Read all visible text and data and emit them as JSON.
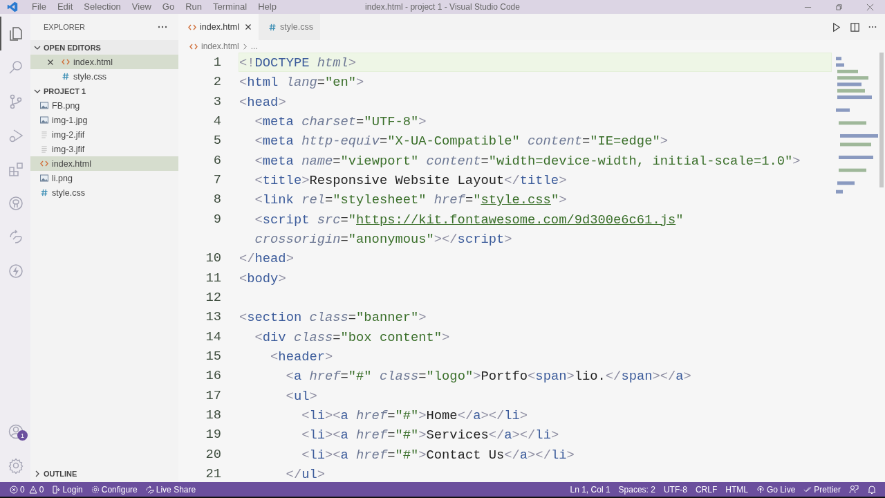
{
  "window": {
    "title": "index.html - project 1 - Visual Studio Code"
  },
  "menu": [
    "File",
    "Edit",
    "Selection",
    "View",
    "Go",
    "Run",
    "Terminal",
    "Help"
  ],
  "activity_bar": {
    "top": [
      {
        "kind": "explorer",
        "selected": true
      },
      {
        "kind": "search",
        "selected": false
      },
      {
        "kind": "source-control",
        "selected": false
      },
      {
        "kind": "run",
        "selected": false
      },
      {
        "kind": "extensions",
        "selected": false
      },
      {
        "kind": "github",
        "selected": false
      },
      {
        "kind": "live-share",
        "selected": false
      },
      {
        "kind": "lightning",
        "selected": false
      }
    ],
    "accounts_badge": "1"
  },
  "sidebar": {
    "title": "EXPLORER",
    "open_editors": {
      "label": "OPEN EDITORS",
      "expanded": true,
      "items": [
        {
          "name": "index.html",
          "kind": "html",
          "selected": true
        },
        {
          "name": "style.css",
          "kind": "css",
          "selected": false
        }
      ]
    },
    "project": {
      "label": "PROJECT 1",
      "expanded": true,
      "items": [
        {
          "name": "FB.png",
          "kind": "image",
          "selected": false
        },
        {
          "name": "img-1.jpg",
          "kind": "image",
          "selected": false
        },
        {
          "name": "img-2.jfif",
          "kind": "file",
          "selected": false
        },
        {
          "name": "img-3.jfif",
          "kind": "file",
          "selected": false
        },
        {
          "name": "index.html",
          "kind": "html",
          "selected": true
        },
        {
          "name": "li.png",
          "kind": "image",
          "selected": false
        },
        {
          "name": "style.css",
          "kind": "css",
          "selected": false
        }
      ]
    },
    "outline": {
      "label": "OUTLINE",
      "expanded": false
    }
  },
  "tabs": [
    {
      "label": "index.html",
      "kind": "html",
      "selected": true
    },
    {
      "label": "style.css",
      "kind": "css",
      "selected": false
    }
  ],
  "breadcrumb": {
    "file": "index.html",
    "kind": "html",
    "rest": "..."
  },
  "code": [
    {
      "number": "1",
      "current": true,
      "tokens": [
        {
          "kind": "p",
          "text": "<!"
        },
        {
          "kind": "t",
          "text": "DOCTYPE"
        },
        {
          "kind": "a",
          "text": " html"
        },
        {
          "kind": "p",
          "text": ">"
        }
      ]
    },
    {
      "number": "2",
      "current": false,
      "tokens": [
        {
          "kind": "p",
          "text": "<"
        },
        {
          "kind": "t",
          "text": "html"
        },
        {
          "kind": "a",
          "text": " lang"
        },
        {
          "kind": "o",
          "text": "="
        },
        {
          "kind": "s",
          "text": "\"en\""
        },
        {
          "kind": "p",
          "text": ">"
        }
      ]
    },
    {
      "number": "3",
      "current": false,
      "tokens": [
        {
          "kind": "p",
          "text": "<"
        },
        {
          "kind": "t",
          "text": "head"
        },
        {
          "kind": "p",
          "text": ">"
        }
      ]
    },
    {
      "number": "4",
      "current": false,
      "tokens": [
        {
          "kind": "p",
          "text": "  <"
        },
        {
          "kind": "t",
          "text": "meta"
        },
        {
          "kind": "a",
          "text": " charset"
        },
        {
          "kind": "o",
          "text": "="
        },
        {
          "kind": "s",
          "text": "\"UTF-8\""
        },
        {
          "kind": "p",
          "text": ">"
        }
      ]
    },
    {
      "number": "5",
      "current": false,
      "tokens": [
        {
          "kind": "p",
          "text": "  <"
        },
        {
          "kind": "t",
          "text": "meta"
        },
        {
          "kind": "a",
          "text": " http-equiv"
        },
        {
          "kind": "o",
          "text": "="
        },
        {
          "kind": "s",
          "text": "\"X-UA-Compatible\""
        },
        {
          "kind": "a",
          "text": " content"
        },
        {
          "kind": "o",
          "text": "="
        },
        {
          "kind": "s",
          "text": "\"IE=edge\""
        },
        {
          "kind": "p",
          "text": ">"
        }
      ]
    },
    {
      "number": "6",
      "current": false,
      "tokens": [
        {
          "kind": "p",
          "text": "  <"
        },
        {
          "kind": "t",
          "text": "meta"
        },
        {
          "kind": "a",
          "text": " name"
        },
        {
          "kind": "o",
          "text": "="
        },
        {
          "kind": "s",
          "text": "\"viewport\""
        },
        {
          "kind": "a",
          "text": " content"
        },
        {
          "kind": "o",
          "text": "="
        },
        {
          "kind": "s",
          "text": "\"width=device-width, initial-scale=1.0\""
        },
        {
          "kind": "p",
          "text": ">"
        }
      ]
    },
    {
      "number": "7",
      "current": false,
      "tokens": [
        {
          "kind": "p",
          "text": "  <"
        },
        {
          "kind": "t",
          "text": "title"
        },
        {
          "kind": "p",
          "text": ">"
        },
        {
          "kind": "x",
          "text": "Responsive Website Layout"
        },
        {
          "kind": "p",
          "text": "</"
        },
        {
          "kind": "t",
          "text": "title"
        },
        {
          "kind": "p",
          "text": ">"
        }
      ]
    },
    {
      "number": "8",
      "current": false,
      "tokens": [
        {
          "kind": "p",
          "text": "  <"
        },
        {
          "kind": "t",
          "text": "link"
        },
        {
          "kind": "a",
          "text": " rel"
        },
        {
          "kind": "o",
          "text": "="
        },
        {
          "kind": "s",
          "text": "\"stylesheet\""
        },
        {
          "kind": "a",
          "text": " href"
        },
        {
          "kind": "o",
          "text": "="
        },
        {
          "kind": "s",
          "text": "\""
        },
        {
          "kind": "l",
          "text": "style.css"
        },
        {
          "kind": "s",
          "text": "\""
        },
        {
          "kind": "p",
          "text": ">"
        }
      ]
    },
    {
      "number": "9",
      "current": false,
      "tokens": [
        {
          "kind": "p",
          "text": "  <"
        },
        {
          "kind": "t",
          "text": "script"
        },
        {
          "kind": "a",
          "text": " src"
        },
        {
          "kind": "o",
          "text": "="
        },
        {
          "kind": "s",
          "text": "\""
        },
        {
          "kind": "l",
          "text": "https://kit.fontawesome.com/9d300e6c61.js"
        },
        {
          "kind": "s",
          "text": "\""
        }
      ]
    },
    {
      "current": false,
      "tokens": [
        {
          "kind": "a",
          "text": "  crossorigin"
        },
        {
          "kind": "o",
          "text": "="
        },
        {
          "kind": "s",
          "text": "\"anonymous\""
        },
        {
          "kind": "p",
          "text": "></"
        },
        {
          "kind": "t",
          "text": "script"
        },
        {
          "kind": "p",
          "text": ">"
        }
      ]
    },
    {
      "number": "10",
      "current": false,
      "tokens": [
        {
          "kind": "p",
          "text": "</"
        },
        {
          "kind": "t",
          "text": "head"
        },
        {
          "kind": "p",
          "text": ">"
        }
      ]
    },
    {
      "number": "11",
      "current": false,
      "tokens": [
        {
          "kind": "p",
          "text": "<"
        },
        {
          "kind": "t",
          "text": "body"
        },
        {
          "kind": "p",
          "text": ">"
        }
      ]
    },
    {
      "number": "12",
      "current": false
    },
    {
      "number": "13",
      "current": false,
      "tokens": [
        {
          "kind": "p",
          "text": "<"
        },
        {
          "kind": "t",
          "text": "section"
        },
        {
          "kind": "a",
          "text": " class"
        },
        {
          "kind": "o",
          "text": "="
        },
        {
          "kind": "s",
          "text": "\"banner\""
        },
        {
          "kind": "p",
          "text": ">"
        }
      ]
    },
    {
      "number": "14",
      "current": false,
      "tokens": [
        {
          "kind": "p",
          "text": "  <"
        },
        {
          "kind": "t",
          "text": "div"
        },
        {
          "kind": "a",
          "text": " class"
        },
        {
          "kind": "o",
          "text": "="
        },
        {
          "kind": "s",
          "text": "\"box content\""
        },
        {
          "kind": "p",
          "text": ">"
        }
      ]
    },
    {
      "number": "15",
      "current": false,
      "tokens": [
        {
          "kind": "p",
          "text": "    <"
        },
        {
          "kind": "t",
          "text": "header"
        },
        {
          "kind": "p",
          "text": ">"
        }
      ]
    },
    {
      "number": "16",
      "current": false,
      "tokens": [
        {
          "kind": "p",
          "text": "      <"
        },
        {
          "kind": "t",
          "text": "a"
        },
        {
          "kind": "a",
          "text": " href"
        },
        {
          "kind": "o",
          "text": "="
        },
        {
          "kind": "s",
          "text": "\"#\""
        },
        {
          "kind": "a",
          "text": " class"
        },
        {
          "kind": "o",
          "text": "="
        },
        {
          "kind": "s",
          "text": "\"logo\""
        },
        {
          "kind": "p",
          "text": ">"
        },
        {
          "kind": "x",
          "text": "Portfo"
        },
        {
          "kind": "p",
          "text": "<"
        },
        {
          "kind": "t",
          "text": "span"
        },
        {
          "kind": "p",
          "text": ">"
        },
        {
          "kind": "x",
          "text": "lio."
        },
        {
          "kind": "p",
          "text": "</"
        },
        {
          "kind": "t",
          "text": "span"
        },
        {
          "kind": "p",
          "text": "></"
        },
        {
          "kind": "t",
          "text": "a"
        },
        {
          "kind": "p",
          "text": ">"
        }
      ]
    },
    {
      "number": "17",
      "current": false,
      "tokens": [
        {
          "kind": "p",
          "text": "      <"
        },
        {
          "kind": "t",
          "text": "ul"
        },
        {
          "kind": "p",
          "text": ">"
        }
      ]
    },
    {
      "number": "18",
      "current": false,
      "tokens": [
        {
          "kind": "p",
          "text": "        <"
        },
        {
          "kind": "t",
          "text": "li"
        },
        {
          "kind": "p",
          "text": "><"
        },
        {
          "kind": "t",
          "text": "a"
        },
        {
          "kind": "a",
          "text": " href"
        },
        {
          "kind": "o",
          "text": "="
        },
        {
          "kind": "s",
          "text": "\"#\""
        },
        {
          "kind": "p",
          "text": ">"
        },
        {
          "kind": "x",
          "text": "Home"
        },
        {
          "kind": "p",
          "text": "</"
        },
        {
          "kind": "t",
          "text": "a"
        },
        {
          "kind": "p",
          "text": "></"
        },
        {
          "kind": "t",
          "text": "li"
        },
        {
          "kind": "p",
          "text": ">"
        }
      ]
    },
    {
      "number": "19",
      "current": false,
      "tokens": [
        {
          "kind": "p",
          "text": "        <"
        },
        {
          "kind": "t",
          "text": "li"
        },
        {
          "kind": "p",
          "text": "><"
        },
        {
          "kind": "t",
          "text": "a"
        },
        {
          "kind": "a",
          "text": " href"
        },
        {
          "kind": "o",
          "text": "="
        },
        {
          "kind": "s",
          "text": "\"#\""
        },
        {
          "kind": "p",
          "text": ">"
        },
        {
          "kind": "x",
          "text": "Services"
        },
        {
          "kind": "p",
          "text": "</"
        },
        {
          "kind": "t",
          "text": "a"
        },
        {
          "kind": "p",
          "text": "></"
        },
        {
          "kind": "t",
          "text": "li"
        },
        {
          "kind": "p",
          "text": ">"
        }
      ]
    },
    {
      "number": "20",
      "current": false,
      "tokens": [
        {
          "kind": "p",
          "text": "        <"
        },
        {
          "kind": "t",
          "text": "li"
        },
        {
          "kind": "p",
          "text": "><"
        },
        {
          "kind": "t",
          "text": "a"
        },
        {
          "kind": "a",
          "text": " href"
        },
        {
          "kind": "o",
          "text": "="
        },
        {
          "kind": "s",
          "text": "\"#\""
        },
        {
          "kind": "p",
          "text": ">"
        },
        {
          "kind": "x",
          "text": "Contact Us"
        },
        {
          "kind": "p",
          "text": "</"
        },
        {
          "kind": "t",
          "text": "a"
        },
        {
          "kind": "p",
          "text": "></"
        },
        {
          "kind": "t",
          "text": "li"
        },
        {
          "kind": "p",
          "text": ">"
        }
      ]
    },
    {
      "number": "21",
      "current": false,
      "tokens": [
        {
          "kind": "p",
          "text": "      </"
        },
        {
          "kind": "t",
          "text": "ul"
        },
        {
          "kind": "p",
          "text": ">"
        }
      ]
    }
  ],
  "status_bar": {
    "left": [
      {
        "kind": "errors",
        "text": "0"
      },
      {
        "kind": "warnings",
        "text": "0"
      },
      {
        "kind": "login",
        "text": "Login"
      },
      {
        "kind": "configure",
        "text": "Configure"
      },
      {
        "kind": "live-share",
        "text": "Live Share"
      }
    ],
    "right": [
      {
        "kind": "plain",
        "text": "Ln 1, Col 1"
      },
      {
        "kind": "plain",
        "text": "Spaces: 2"
      },
      {
        "kind": "plain",
        "text": "UTF-8"
      },
      {
        "kind": "plain",
        "text": "CRLF"
      },
      {
        "kind": "plain",
        "text": "HTML"
      },
      {
        "kind": "go-live",
        "text": "Go Live"
      },
      {
        "kind": "prettier",
        "text": "Prettier"
      },
      {
        "kind": "feedback"
      },
      {
        "kind": "bell"
      }
    ]
  }
}
